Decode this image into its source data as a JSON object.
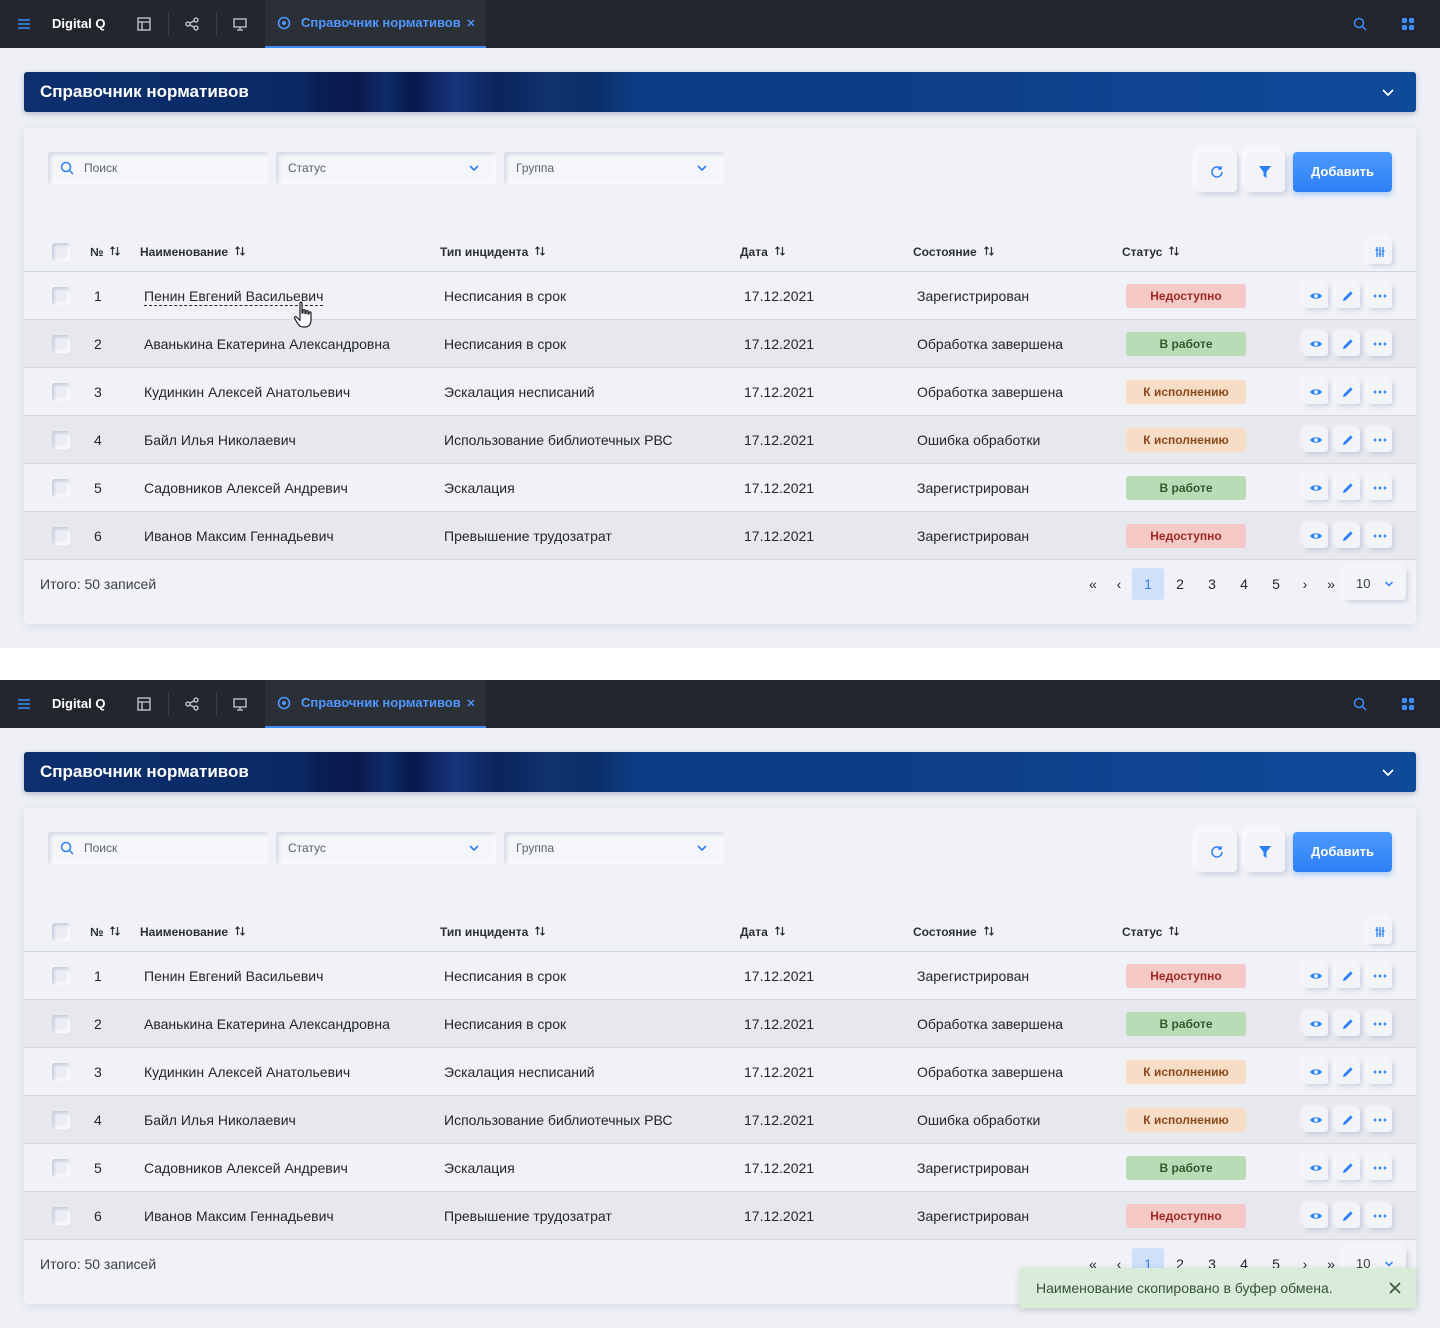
{
  "app": {
    "brand": "Digital Q",
    "active_tab": "Справочник нормативов"
  },
  "page": {
    "title": "Справочник нормативов"
  },
  "filters": {
    "search_placeholder": "Поиск",
    "status_placeholder": "Статус",
    "group_placeholder": "Группа",
    "add_label": "Добавить"
  },
  "table": {
    "columns": {
      "num": "№",
      "name": "Наименование",
      "type": "Тип инцидента",
      "date": "Дата",
      "state": "Состояние",
      "status": "Статус"
    },
    "rows": [
      {
        "num": "1",
        "name": "Пенин Евгений Васильевич",
        "type": "Несписания в срок",
        "date": "17.12.2021",
        "state": "Зарегистрирован",
        "status": "Недоступно"
      },
      {
        "num": "2",
        "name": "Аванькина Екатерина Александровна",
        "type": "Несписания в срок",
        "date": "17.12.2021",
        "state": "Обработка завершена",
        "status": "В работе"
      },
      {
        "num": "3",
        "name": "Кудинкин Алексей Анатольевич",
        "type": "Эскалация несписаний",
        "date": "17.12.2021",
        "state": "Обработка завершена",
        "status": "К исполнению"
      },
      {
        "num": "4",
        "name": "Байл Илья Николаевич",
        "type": "Использование библиотечных РВС",
        "date": "17.12.2021",
        "state": "Ошибка обработки",
        "status": "К исполнению"
      },
      {
        "num": "5",
        "name": "Садовников Алексей Андревич",
        "type": "Эскалация",
        "date": "17.12.2021",
        "state": "Зарегистрирован",
        "status": "В работе"
      },
      {
        "num": "6",
        "name": "Иванов Максим Геннадьевич",
        "type": "Превышение трудозатрат",
        "date": "17.12.2021",
        "state": "Зарегистрирован",
        "status": "Недоступно"
      }
    ]
  },
  "status_colors": {
    "Недоступно": {
      "bg": "#f5c9c6",
      "fg": "#9b2a25"
    },
    "В работе": {
      "bg": "#b9dcb6",
      "fg": "#2f5b2c"
    },
    "К исполнению": {
      "bg": "#f7dcc6",
      "fg": "#8a4a1c"
    }
  },
  "pagination": {
    "total": "Итого: 50 записей",
    "first": "«",
    "prev": "‹",
    "pages": [
      "1",
      "2",
      "3",
      "4",
      "5"
    ],
    "active_page": "1",
    "next": "›",
    "last": "»",
    "per_page": "10"
  },
  "toast": {
    "message": "Наименование скопировано в буфер обмена."
  },
  "icons": [
    "menu-icon",
    "layout-icon",
    "share-icon",
    "monitor-icon",
    "tab-icon",
    "close-icon",
    "search-icon",
    "apps-icon",
    "chevron-down-icon",
    "refresh-icon",
    "filter-icon",
    "sort-icon",
    "columns-icon",
    "eye-icon",
    "pencil-icon",
    "more-icon",
    "cursor-hand-icon"
  ],
  "colors": {
    "accent": "#2d7ff5",
    "topbar": "#23262c"
  }
}
